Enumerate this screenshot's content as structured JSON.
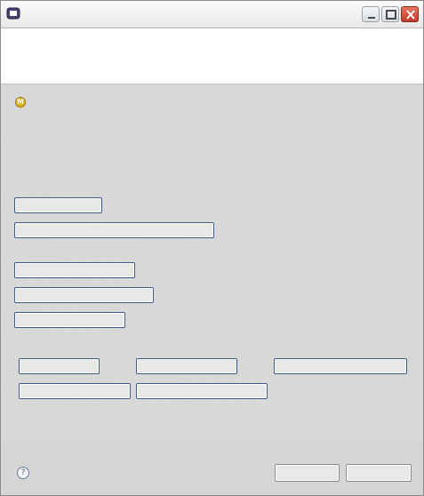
{
  "window": {
    "title": ""
  },
  "header": {
    "title": ""
  },
  "info": {
    "icon": "info-icon",
    "icon_glyph": "M"
  },
  "sections": [
    {
      "heading": "",
      "value": ""
    },
    {
      "heading": "",
      "value": ""
    }
  ],
  "buttons": {
    "b1": "",
    "b2": "",
    "b3": "",
    "b4": "",
    "b5": "",
    "b6": "",
    "b7": "",
    "b8": "",
    "b9": "",
    "b10": ""
  },
  "footer": {
    "help_glyph": "?",
    "finish_label": "",
    "cancel_label": ""
  },
  "colors": {
    "close_button": "#c0392b",
    "button_border": "#3d5a8a",
    "info_icon": "#e0b21b"
  }
}
